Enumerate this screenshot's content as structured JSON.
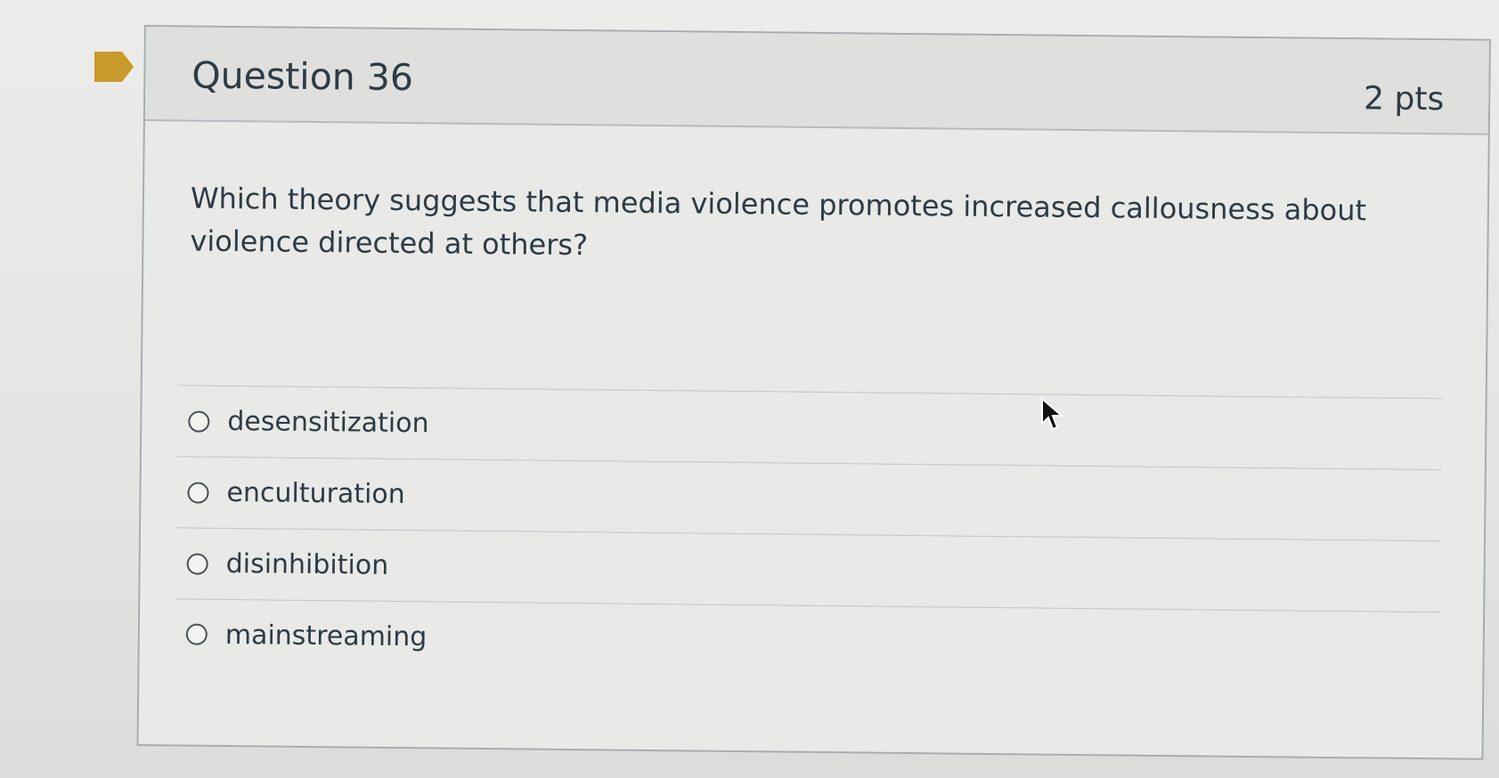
{
  "question": {
    "title": "Question 36",
    "points": "2 pts",
    "text": "Which theory suggests that media violence promotes increased callousness about violence directed at others?",
    "answers": [
      {
        "label": "desensitization",
        "selected": false
      },
      {
        "label": "enculturation",
        "selected": false
      },
      {
        "label": "disinhibition",
        "selected": false
      },
      {
        "label": "mainstreaming",
        "selected": false
      }
    ]
  },
  "icons": {
    "flag": "flag-icon",
    "cursor": "mouse-pointer-icon"
  },
  "colors": {
    "flag": "#c89a2b",
    "text": "#2d3b45",
    "border": "#a9acaf"
  }
}
